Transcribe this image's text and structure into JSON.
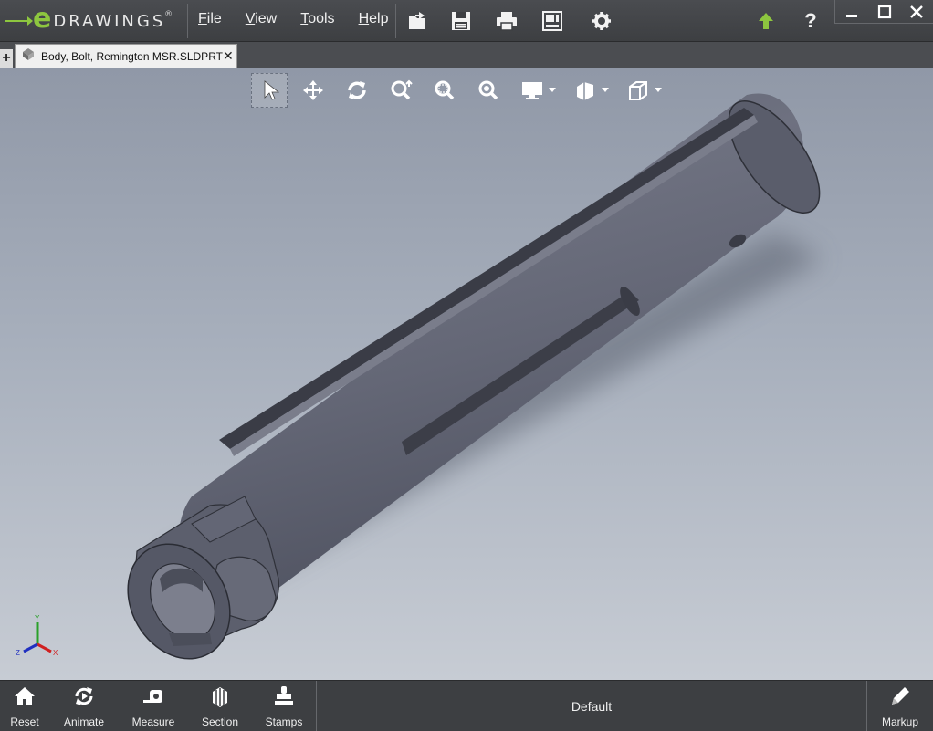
{
  "app": {
    "logo_letter": "e",
    "logo_word": "DRAWINGS",
    "logo_mark": "®"
  },
  "menu": {
    "items": [
      {
        "label": "File"
      },
      {
        "label": "View"
      },
      {
        "label": "Tools"
      },
      {
        "label": "Help"
      }
    ]
  },
  "toolbar": {
    "icons": [
      "open-icon",
      "save-icon",
      "print-icon",
      "sheet-icon",
      "settings-icon"
    ]
  },
  "header_right": {
    "update_icon": "green-up-arrow-icon",
    "help_label": "?"
  },
  "tabs": {
    "new_tab_label": "+",
    "document_title": "Body, Bolt, Remington MSR.SLDPRT",
    "close_label": "✕"
  },
  "view_tools": [
    "select-icon",
    "pan-icon",
    "rotate-icon",
    "zoom-icon",
    "zoom-area-icon",
    "zoom-fit-icon",
    "display-style-icon",
    "hide-show-icon",
    "view-orientation-icon"
  ],
  "triad": {
    "x": "X",
    "y": "Y",
    "z": "Z"
  },
  "bottom": {
    "reset_label": "Reset",
    "animate_label": "Animate",
    "measure_label": "Measure",
    "section_label": "Section",
    "stamps_label": "Stamps",
    "configuration": "Default",
    "markup_label": "Markup"
  },
  "colors": {
    "accent_green": "#8dc63f",
    "chrome": "#3d3f42",
    "viewport_top": "#9098a7",
    "viewport_bottom": "#c7ccd4",
    "part": "#5e6170"
  }
}
